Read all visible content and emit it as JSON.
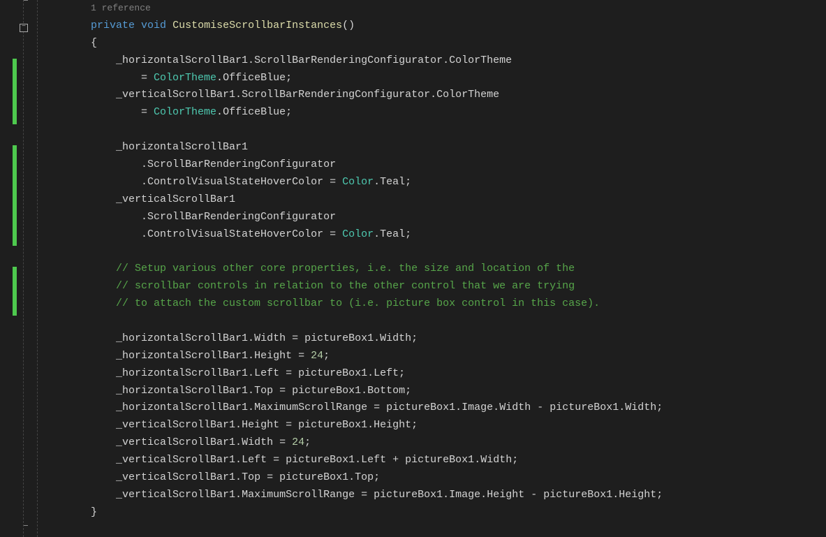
{
  "editor": {
    "reference_text": "1 reference",
    "collapse_symbol": "−",
    "tokens": {
      "kw_private": "private",
      "kw_void": "void",
      "method_name": "CustomiseScrollbarInstances",
      "open_brace": "{",
      "close_brace": "}",
      "color_theme_class": "ColorTheme",
      "office_blue": "OfficeBlue",
      "color_class": "Color",
      "teal": "Teal",
      "num24": "24",
      "comment1": "// Setup various other core properties, i.e. the size and location of the",
      "comment2": "// scrollbar controls in relation to the other control that we are trying",
      "comment3": "// to attach the custom scrollbar to (i.e. picture box control in this case).",
      "h_sb": "_horizontalScrollBar1",
      "v_sb": "_verticalScrollBar1",
      "pbox": "pictureBox1",
      "sbc": "ScrollBarRenderingConfigurator",
      "ct": "ColorTheme",
      "cvhc": "ControlVisualStateHoverColor",
      "width": "Width",
      "height": "Height",
      "left": "Left",
      "top": "Top",
      "bottom": "Bottom",
      "msr": "MaximumScrollRange",
      "image": "Image",
      "eq": " = ",
      "eq2": "= ",
      "dot": ".",
      "semi": ";",
      "plus": " + ",
      "minus": " - ",
      "paren_open": "(",
      "paren_close": ")"
    }
  }
}
